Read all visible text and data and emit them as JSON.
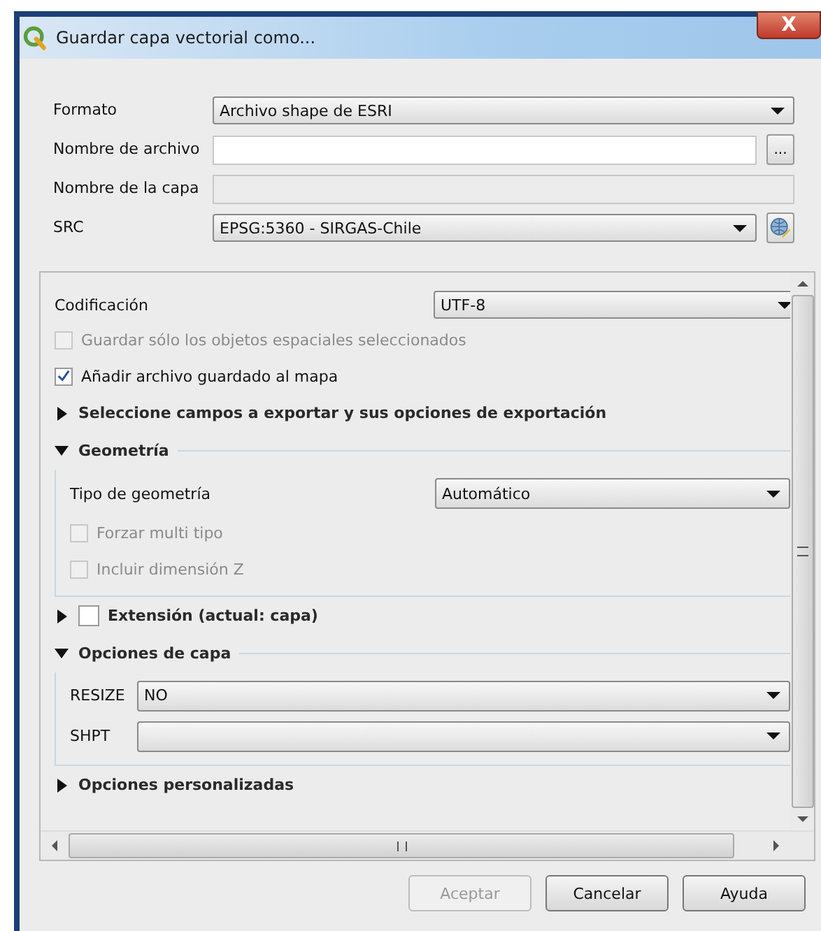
{
  "window": {
    "title": "Guardar capa vectorial como...",
    "close": "X"
  },
  "form": [
    {
      "kind": "combo",
      "label": "Formato",
      "value": "Archivo shape de ESRI"
    },
    {
      "kind": "file",
      "label": "Nombre de archivo",
      "button": "..."
    },
    {
      "kind": "text",
      "label": "Nombre de la capa",
      "disabled": true
    },
    {
      "kind": "crs",
      "label": "SRC",
      "value": "EPSG:5360 - SIRGAS-Chile"
    }
  ],
  "encoding": {
    "label": "Codificación",
    "value": "UTF-8"
  },
  "checks": [
    {
      "label": "Guardar sólo los objetos espaciales seleccionados",
      "checked": false,
      "disabled": true
    },
    {
      "label": "Añadir archivo guardado al mapa",
      "checked": true,
      "disabled": false
    }
  ],
  "sections": [
    {
      "title": "Seleccione campos a exportar y sus opciones de exportación",
      "expanded": false
    },
    {
      "title": "Geometría",
      "expanded": true,
      "rows": [
        {
          "kind": "combo",
          "label": "Tipo de geometría",
          "value": "Automático"
        },
        {
          "kind": "check",
          "label": "Forzar multi tipo",
          "checked": false,
          "disabled": true
        },
        {
          "kind": "check",
          "label": "Incluir dimensión Z",
          "checked": false,
          "disabled": true
        }
      ]
    },
    {
      "title": "Extensión (actual: capa)",
      "expanded": false,
      "checked": false
    },
    {
      "title": "Opciones de capa",
      "expanded": true,
      "rows": [
        {
          "kind": "option",
          "label": "RESIZE",
          "value": "NO"
        },
        {
          "kind": "option",
          "label": "SHPT"
        }
      ]
    },
    {
      "title": "Opciones personalizadas",
      "expanded": false
    }
  ],
  "buttons": [
    {
      "label": "Aceptar",
      "disabled": true
    },
    {
      "label": "Cancelar",
      "disabled": false
    },
    {
      "label": "Ayuda",
      "disabled": false
    }
  ]
}
